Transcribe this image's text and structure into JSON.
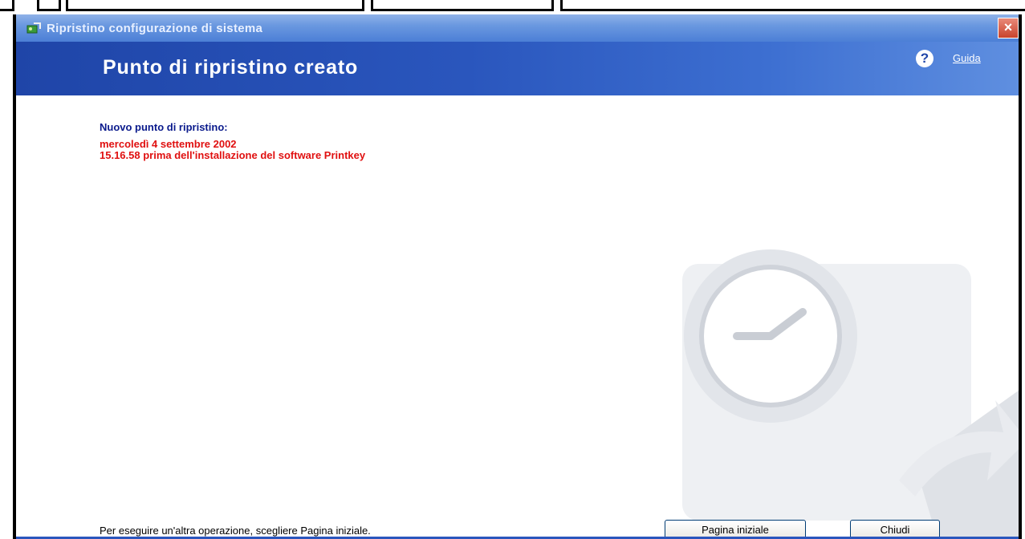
{
  "window": {
    "title": "Ripristino configurazione di sistema",
    "close_label": "×"
  },
  "header": {
    "title": "Punto di ripristino creato",
    "help_icon": "?",
    "help_label": "Guida"
  },
  "content": {
    "new_point_label": "Nuovo punto di ripristino:",
    "date": "mercoledì 4 settembre 2002",
    "description": "15.16.58 prima dell'installazione del software Printkey"
  },
  "footer": {
    "instruction": "Per eseguire un'altra operazione, scegliere Pagina iniziale.",
    "home_button": "Pagina iniziale",
    "close_button": "Chiudi"
  },
  "colors": {
    "header_blue": "#2a56bd",
    "label_blue": "#0a1a8c",
    "highlight_red": "#e01010"
  },
  "icons": [
    "system-restore-icon",
    "help-icon",
    "close-icon",
    "clock-watermark-icon"
  ]
}
